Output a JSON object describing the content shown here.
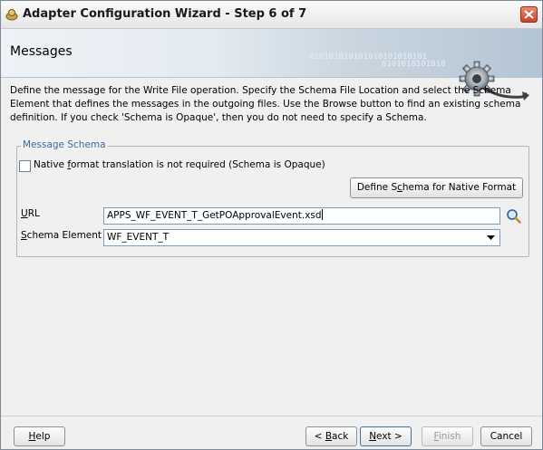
{
  "window": {
    "title": "Adapter Configuration Wizard - Step 6 of 7"
  },
  "header": {
    "title": "Messages",
    "binary_text": "010101010101010101010101",
    "binary_text2": "0101010101010"
  },
  "description": "Define the message for the Write File operation.  Specify the Schema File Location and select the Schema Element that defines the messages in the outgoing files. Use the Browse button to find an existing schema definition. If you check 'Schema is Opaque', then you do not need to specify a Schema.",
  "schema": {
    "legend": "Message Schema",
    "opaque_checkbox": {
      "label_pre": "Native ",
      "label_mnemonic": "f",
      "label_post": "ormat translation is not required (Schema is Opaque)",
      "checked": false
    },
    "define_button": {
      "pre": "Define S",
      "mnemonic": "c",
      "post": "hema for Native Format"
    },
    "url_label": {
      "mnemonic": "U",
      "post": "RL"
    },
    "url_value": "APPS_WF_EVENT_T_GetPOApprovalEvent.xsd",
    "element_label": {
      "mnemonic": "S",
      "post": "chema Element"
    },
    "element_value": "WF_EVENT_T"
  },
  "footer": {
    "help": {
      "mnemonic": "H",
      "post": "elp"
    },
    "back": {
      "pre": "< ",
      "mnemonic": "B",
      "post": "ack"
    },
    "next": {
      "mnemonic": "N",
      "post": "ext >"
    },
    "finish": {
      "mnemonic": "F",
      "post": "inish"
    },
    "cancel": "Cancel"
  },
  "colors": {
    "legend": "#3c6aa5",
    "close_button": "#c6442a"
  }
}
